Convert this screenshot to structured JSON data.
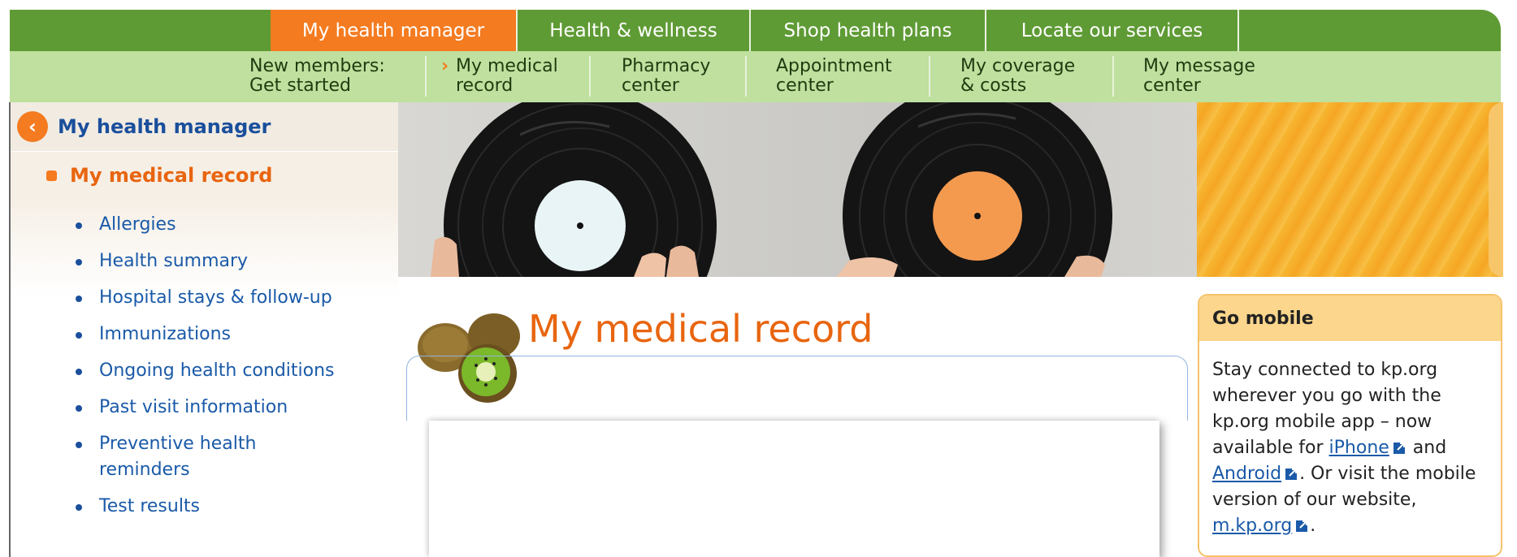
{
  "topnav": {
    "tabs": [
      {
        "label": "My health manager",
        "active": true
      },
      {
        "label": "Health & wellness"
      },
      {
        "label": "Shop health plans"
      },
      {
        "label": "Locate our services"
      }
    ]
  },
  "subnav": {
    "items": [
      {
        "line1": "New members:",
        "line2": "Get started"
      },
      {
        "line1": "My medical",
        "line2": "record",
        "current": true
      },
      {
        "line1": "Pharmacy",
        "line2": "center"
      },
      {
        "line1": "Appointment",
        "line2": "center"
      },
      {
        "line1": "My coverage",
        "line2": "& costs"
      },
      {
        "line1": "My message",
        "line2": "center"
      }
    ]
  },
  "sidebar": {
    "title": "My health manager",
    "subtitle": "My medical record",
    "links": [
      "Allergies",
      "Health summary",
      "Hospital stays & follow-up",
      "Immunizations",
      "Ongoing health conditions",
      "Past visit information",
      "Preventive health reminders",
      "Test results"
    ]
  },
  "main": {
    "title": "My medical record"
  },
  "gomobile": {
    "heading": "Go mobile",
    "text1": "Stay connected to kp.org wherever you go with the kp.org mobile app – now available for ",
    "link_iphone": "iPhone",
    "text2": " and ",
    "link_android": "Android",
    "text3": ". Or visit the mobile version of our website, ",
    "link_mobile": "m.kp.org",
    "text4": "."
  },
  "colors": {
    "green": "#5f9b35",
    "orange": "#f47b20",
    "lightgreen": "#bfe09e",
    "link": "#1a5aa8"
  }
}
